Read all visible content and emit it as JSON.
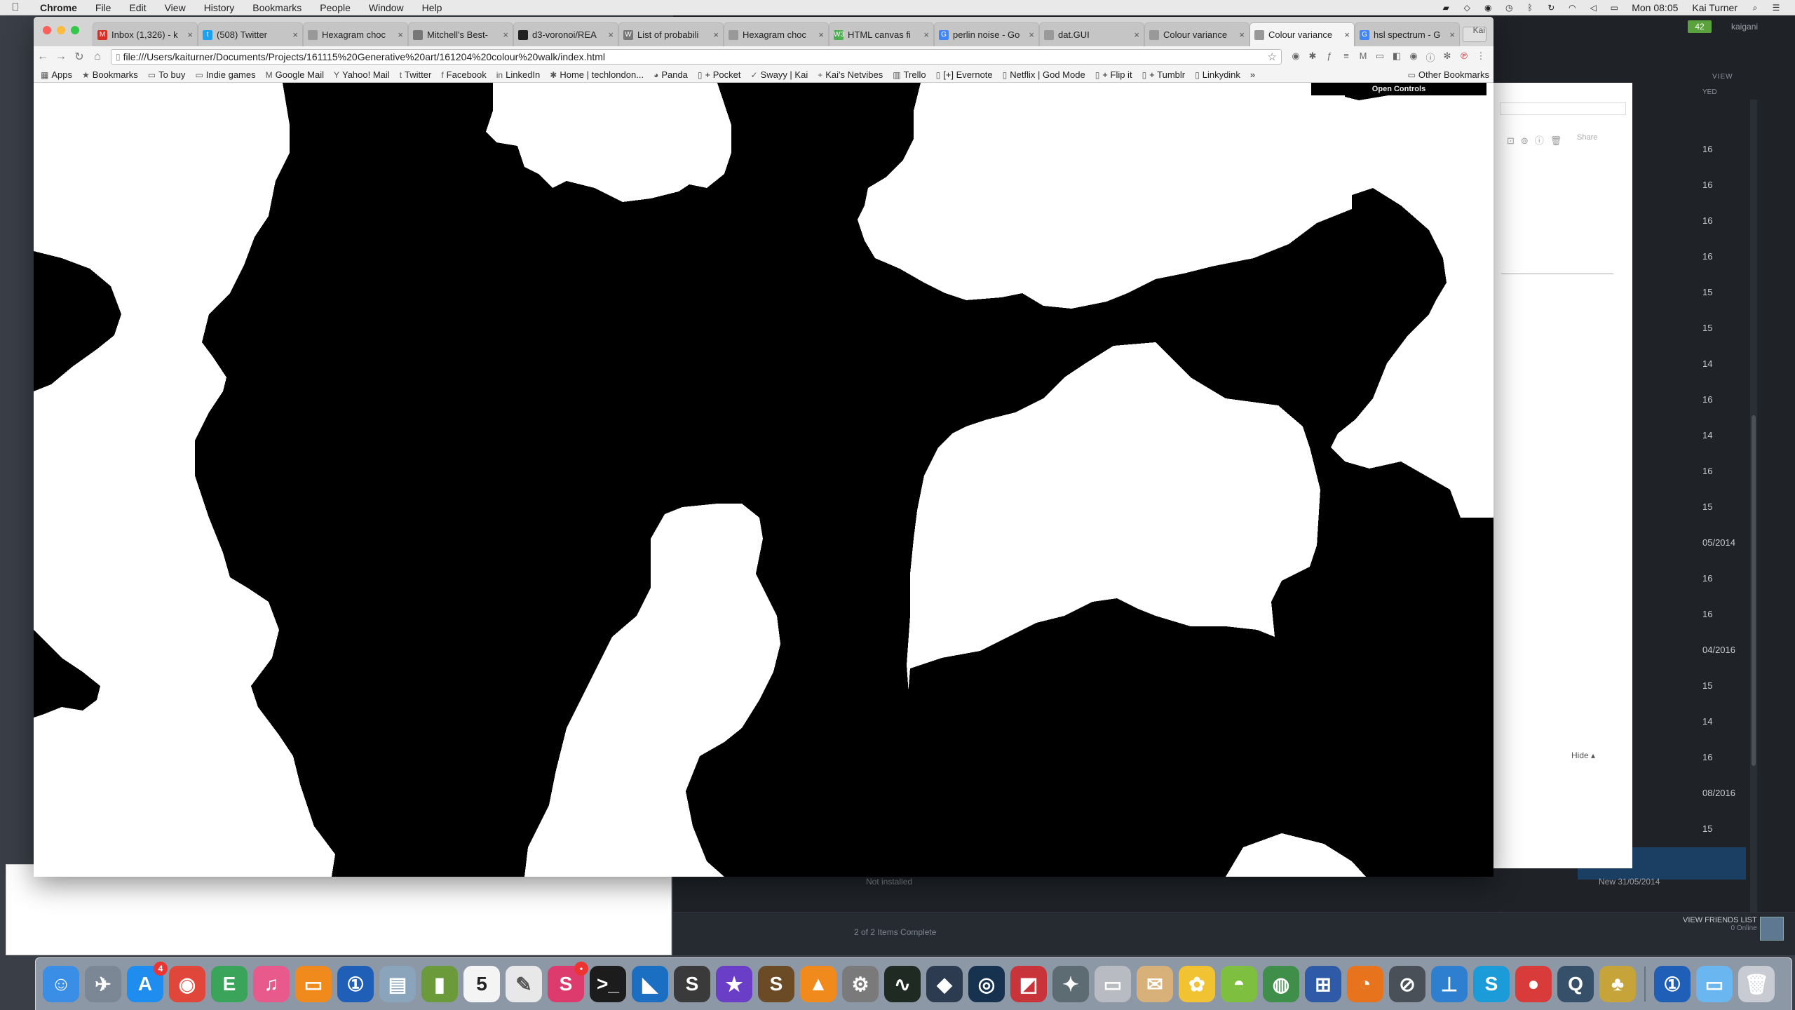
{
  "menubar": {
    "apple": "",
    "app_name": "Chrome",
    "menus": [
      "File",
      "Edit",
      "View",
      "History",
      "Bookmarks",
      "People",
      "Window",
      "Help"
    ],
    "clock": "Mon 08:05",
    "user": "Kai Turner"
  },
  "chrome": {
    "tabs": [
      {
        "title": "Inbox (1,326) - k",
        "fav": "M",
        "color": "#d93025"
      },
      {
        "title": "(508) Twitter",
        "fav": "t",
        "color": "#1da1f2"
      },
      {
        "title": "Hexagram choc",
        "fav": "",
        "color": "#999"
      },
      {
        "title": "Mitchell's Best-",
        "fav": "",
        "color": "#777"
      },
      {
        "title": "d3-voronoi/REA",
        "fav": "",
        "color": "#222"
      },
      {
        "title": "List of probabili",
        "fav": "W",
        "color": "#777"
      },
      {
        "title": "Hexagram choc",
        "fav": "",
        "color": "#999"
      },
      {
        "title": "HTML canvas fi",
        "fav": "W3",
        "color": "#4caf50"
      },
      {
        "title": "perlin noise - Go",
        "fav": "G",
        "color": "#4285f4"
      },
      {
        "title": "dat.GUI",
        "fav": "",
        "color": "#999"
      },
      {
        "title": "Colour variance",
        "fav": "",
        "color": "#999"
      },
      {
        "title": "Colour variance",
        "fav": "",
        "color": "#999"
      },
      {
        "title": "hsl spectrum - G",
        "fav": "G",
        "color": "#4285f4"
      }
    ],
    "active_tab": 11,
    "profile": "Kai",
    "url": "file:///Users/kaiturner/Documents/Projects/161115%20Generative%20art/161204%20colour%20walk/index.html",
    "bookmarks": [
      {
        "label": "Apps",
        "icon": "▦"
      },
      {
        "label": "Bookmarks",
        "icon": "★"
      },
      {
        "label": "To buy",
        "icon": "▭"
      },
      {
        "label": "Indie games",
        "icon": "▭"
      },
      {
        "label": "Google Mail",
        "icon": "M"
      },
      {
        "label": "Yahoo! Mail",
        "icon": "Y"
      },
      {
        "label": "Twitter",
        "icon": "t"
      },
      {
        "label": "Facebook",
        "icon": "f"
      },
      {
        "label": "LinkedIn",
        "icon": "in"
      },
      {
        "label": "Home | techlondon...",
        "icon": "✱"
      },
      {
        "label": "Panda",
        "icon": "◕"
      },
      {
        "label": "+ Pocket",
        "icon": "▯"
      },
      {
        "label": "Swayy | Kai",
        "icon": "✓"
      },
      {
        "label": "Kai's Netvibes",
        "icon": "+"
      },
      {
        "label": "Trello",
        "icon": "▥"
      },
      {
        "label": "[+] Evernote",
        "icon": "▯"
      },
      {
        "label": "Netflix | God Mode",
        "icon": "▯"
      },
      {
        "label": "+ Flip it",
        "icon": "▯"
      },
      {
        "label": "+ Tumblr",
        "icon": "▯"
      },
      {
        "label": "Linkydink",
        "icon": "▯"
      }
    ],
    "bookmarks_more": "»",
    "other_bookmarks": "Other Bookmarks",
    "open_controls": "Open Controls"
  },
  "background": {
    "notif_count": "42",
    "username": "kaigani",
    "view_label": "VIEW",
    "list_header": "YED",
    "rows": [
      "16",
      "16",
      "16",
      "16",
      "15",
      "15",
      "14",
      "16",
      "14",
      "16",
      "15",
      "05/2014",
      "16",
      "16",
      "04/2016",
      "15",
      "14",
      "16",
      "08/2016",
      "15"
    ],
    "selected_row": "y",
    "not_installed": "Not installed",
    "new_date": "New  31/05/2014",
    "items_complete": "2 of 2 Items Complete",
    "view_friends": "VIEW FRIENDS LIST",
    "online": "0 Online",
    "share_label": "Share",
    "hide_label": "Hide ▴"
  },
  "dock": {
    "apps": [
      {
        "name": "finder-icon",
        "bg": "#3a8ee6",
        "glyph": "☺"
      },
      {
        "name": "launchpad-icon",
        "bg": "#7b8794",
        "glyph": "✈"
      },
      {
        "name": "app-store-icon",
        "bg": "#1f8cf0",
        "glyph": "A",
        "badge": "4"
      },
      {
        "name": "chrome-icon",
        "bg": "#e0473a",
        "glyph": "◉"
      },
      {
        "name": "evernote-icon",
        "bg": "#3aa45a",
        "glyph": "E"
      },
      {
        "name": "itunes-icon",
        "bg": "#e85a8c",
        "glyph": "♫"
      },
      {
        "name": "ibooks-icon",
        "bg": "#f08a1d",
        "glyph": "▭"
      },
      {
        "name": "onepassword-icon",
        "bg": "#1f5fb8",
        "glyph": "①"
      },
      {
        "name": "preview-icon",
        "bg": "#8aa4bb",
        "glyph": "▤"
      },
      {
        "name": "archive-icon",
        "bg": "#6b9a3a",
        "glyph": "▮"
      },
      {
        "name": "calendar-icon",
        "bg": "#f4f4f4",
        "glyph": "5",
        "text": "#222"
      },
      {
        "name": "textedit-icon",
        "bg": "#e8e8e8",
        "glyph": "✎",
        "text": "#555"
      },
      {
        "name": "skitch-icon",
        "bg": "#dd3b6d",
        "glyph": "S",
        "badge": "•"
      },
      {
        "name": "terminal-icon",
        "bg": "#1c1c1c",
        "glyph": ">_"
      },
      {
        "name": "vscode-icon",
        "bg": "#1a6fc3",
        "glyph": "◣"
      },
      {
        "name": "sublime-icon",
        "bg": "#3a3a3a",
        "glyph": "S"
      },
      {
        "name": "imovie-icon",
        "bg": "#6a3ec7",
        "glyph": "★"
      },
      {
        "name": "slack-icon",
        "bg": "#6b4a26",
        "glyph": "S"
      },
      {
        "name": "vlc-icon",
        "bg": "#f08a1d",
        "glyph": "▲"
      },
      {
        "name": "system-prefs-icon",
        "bg": "#7a7a7a",
        "glyph": "⚙"
      },
      {
        "name": "activity-monitor-icon",
        "bg": "#1f2a22",
        "glyph": "∿"
      },
      {
        "name": "unity-icon",
        "bg": "#2c3b4f",
        "glyph": "◆"
      },
      {
        "name": "steam-icon",
        "bg": "#17324f",
        "glyph": "◎"
      },
      {
        "name": "game-icon",
        "bg": "#c8343a",
        "glyph": "◩"
      },
      {
        "name": "elite-icon",
        "bg": "#5d6b72",
        "glyph": "✦"
      },
      {
        "name": "keyboard-icon",
        "bg": "#b8bcc2",
        "glyph": "▭"
      },
      {
        "name": "mail-icon",
        "bg": "#d8b07a",
        "glyph": "✉"
      },
      {
        "name": "photos-icon",
        "bg": "#f1c232",
        "glyph": "✿"
      },
      {
        "name": "android-icon",
        "bg": "#7fbf3f",
        "glyph": "◓"
      },
      {
        "name": "globe-icon",
        "bg": "#3f8f4a",
        "glyph": "◍"
      },
      {
        "name": "controller-icon",
        "bg": "#2e5aa8",
        "glyph": "⊞"
      },
      {
        "name": "firefox-icon",
        "bg": "#e7731d",
        "glyph": "◔"
      },
      {
        "name": "safari-icon",
        "bg": "#4a5058",
        "glyph": "⊘"
      },
      {
        "name": "keynote-icon",
        "bg": "#2f7fd1",
        "glyph": "⊥"
      },
      {
        "name": "skype-icon",
        "bg": "#1c9bd9",
        "glyph": "S"
      },
      {
        "name": "quicktime-icon",
        "bg": "#d93a3a",
        "glyph": "●"
      },
      {
        "name": "quicktime-player-icon",
        "bg": "#37506a",
        "glyph": "Q"
      },
      {
        "name": "pineapple-icon",
        "bg": "#c7a43a",
        "glyph": "♣"
      }
    ],
    "right_items": [
      {
        "name": "onepassword-mini-icon",
        "bg": "#1f5fb8",
        "glyph": "①"
      },
      {
        "name": "downloads-folder-icon",
        "bg": "#6ab6f0",
        "glyph": "▭"
      },
      {
        "name": "trash-icon",
        "bg": "#c8ccd2",
        "glyph": "🗑"
      }
    ]
  },
  "canvas": {
    "fill_color": "#000000",
    "background_color": "#ffffff"
  }
}
